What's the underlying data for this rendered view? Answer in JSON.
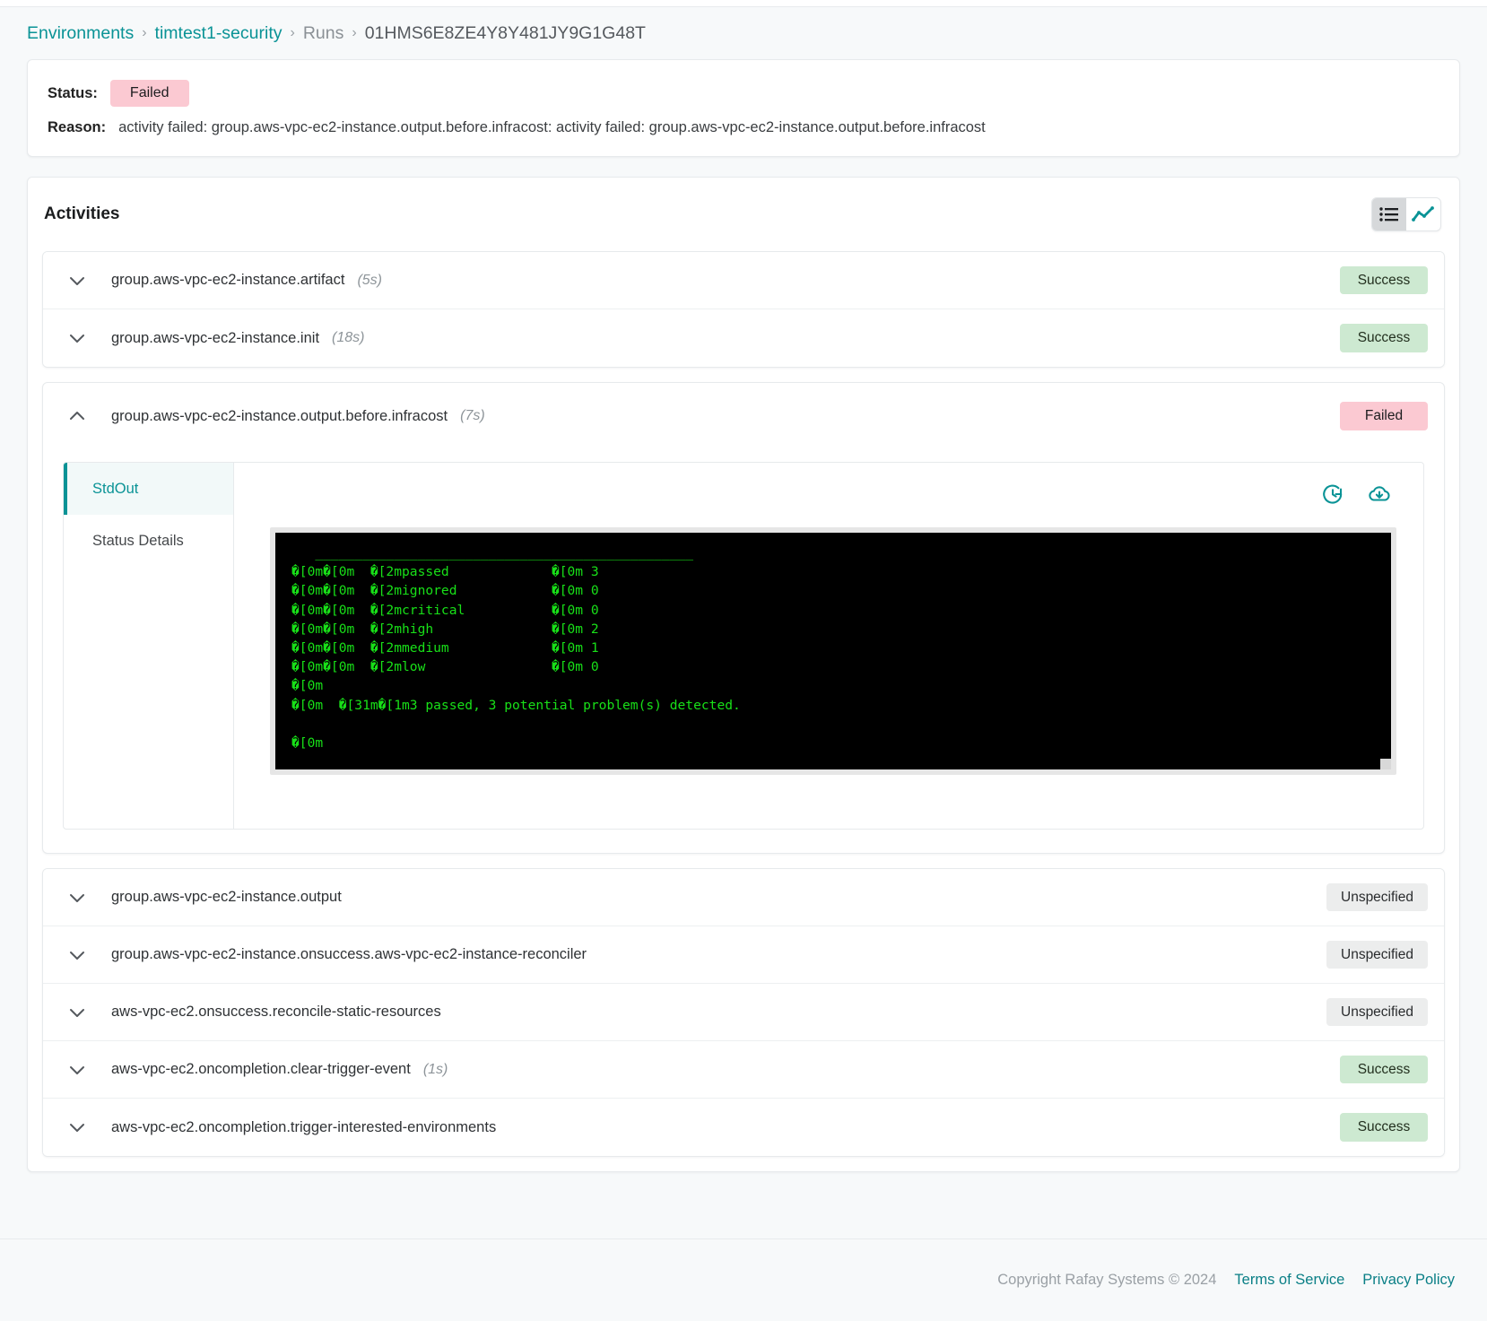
{
  "breadcrumb": {
    "items": [
      {
        "label": "Environments",
        "type": "link"
      },
      {
        "label": "timtest1-security",
        "type": "link"
      },
      {
        "label": "Runs",
        "type": "plain"
      },
      {
        "label": "01HMS6E8ZE4Y8Y481JY9G1G48T",
        "type": "current"
      }
    ],
    "separator": "›"
  },
  "status_card": {
    "status_label": "Status:",
    "status_value": "Failed",
    "reason_label": "Reason:",
    "reason_value": "activity failed: group.aws-vpc-ec2-instance.output.before.infracost: activity failed: group.aws-vpc-ec2-instance.output.before.infracost"
  },
  "activities": {
    "title": "Activities",
    "view_toggle": {
      "list_icon": "list-view-icon",
      "chart_icon": "trend-chart-icon",
      "active": "list"
    },
    "rows": [
      {
        "name": "group.aws-vpc-ec2-instance.artifact",
        "duration": "(5s)",
        "status": "Success",
        "status_kind": "success",
        "expanded": false
      },
      {
        "name": "group.aws-vpc-ec2-instance.init",
        "duration": "(18s)",
        "status": "Success",
        "status_kind": "success",
        "expanded": false
      },
      {
        "name": "group.aws-vpc-ec2-instance.output",
        "duration": "",
        "status": "Unspecified",
        "status_kind": "unspecified",
        "expanded": false
      },
      {
        "name": "group.aws-vpc-ec2-instance.onsuccess.aws-vpc-ec2-instance-reconciler",
        "duration": "",
        "status": "Unspecified",
        "status_kind": "unspecified",
        "expanded": false
      },
      {
        "name": "aws-vpc-ec2.onsuccess.reconcile-static-resources",
        "duration": "",
        "status": "Unspecified",
        "status_kind": "unspecified",
        "expanded": false
      },
      {
        "name": "aws-vpc-ec2.oncompletion.clear-trigger-event",
        "duration": "(1s)",
        "status": "Success",
        "status_kind": "success",
        "expanded": false
      },
      {
        "name": "aws-vpc-ec2.oncompletion.trigger-interested-environments",
        "duration": "",
        "status": "Success",
        "status_kind": "success",
        "expanded": false
      }
    ],
    "expanded_row": {
      "name": "group.aws-vpc-ec2-instance.output.before.infracost",
      "duration": "(7s)",
      "status": "Failed",
      "status_kind": "failed",
      "tabs": [
        {
          "label": "StdOut",
          "active": true
        },
        {
          "label": "Status Details",
          "active": false
        }
      ],
      "log_actions": [
        {
          "icon": "refresh-history-icon"
        },
        {
          "icon": "cloud-download-icon"
        }
      ],
      "terminal_lines": [
        "   ________________________________________________",
        "�[0m�[0m  �[2mpassed             �[0m 3",
        "�[0m�[0m  �[2mignored            �[0m 0",
        "�[0m�[0m  �[2mcritical           �[0m 0",
        "�[0m�[0m  �[2mhigh               �[0m 2",
        "�[0m�[0m  �[2mmedium             �[0m 1",
        "�[0m�[0m  �[2mlow                �[0m 0",
        "�[0m",
        "�[0m  �[31m�[1m3 passed, 3 potential problem(s) detected.",
        "",
        "�[0m"
      ]
    }
  },
  "footer": {
    "copyright": "Copyright Rafay Systems © 2024",
    "terms": "Terms of Service",
    "privacy": "Privacy Policy"
  },
  "colors": {
    "accent": "#0a9396",
    "success_bg": "#cde9d1",
    "failed_bg": "#fbc9d2",
    "unspecified_bg": "#eceded",
    "terminal_bg": "#000000",
    "terminal_fg": "#18e018"
  }
}
